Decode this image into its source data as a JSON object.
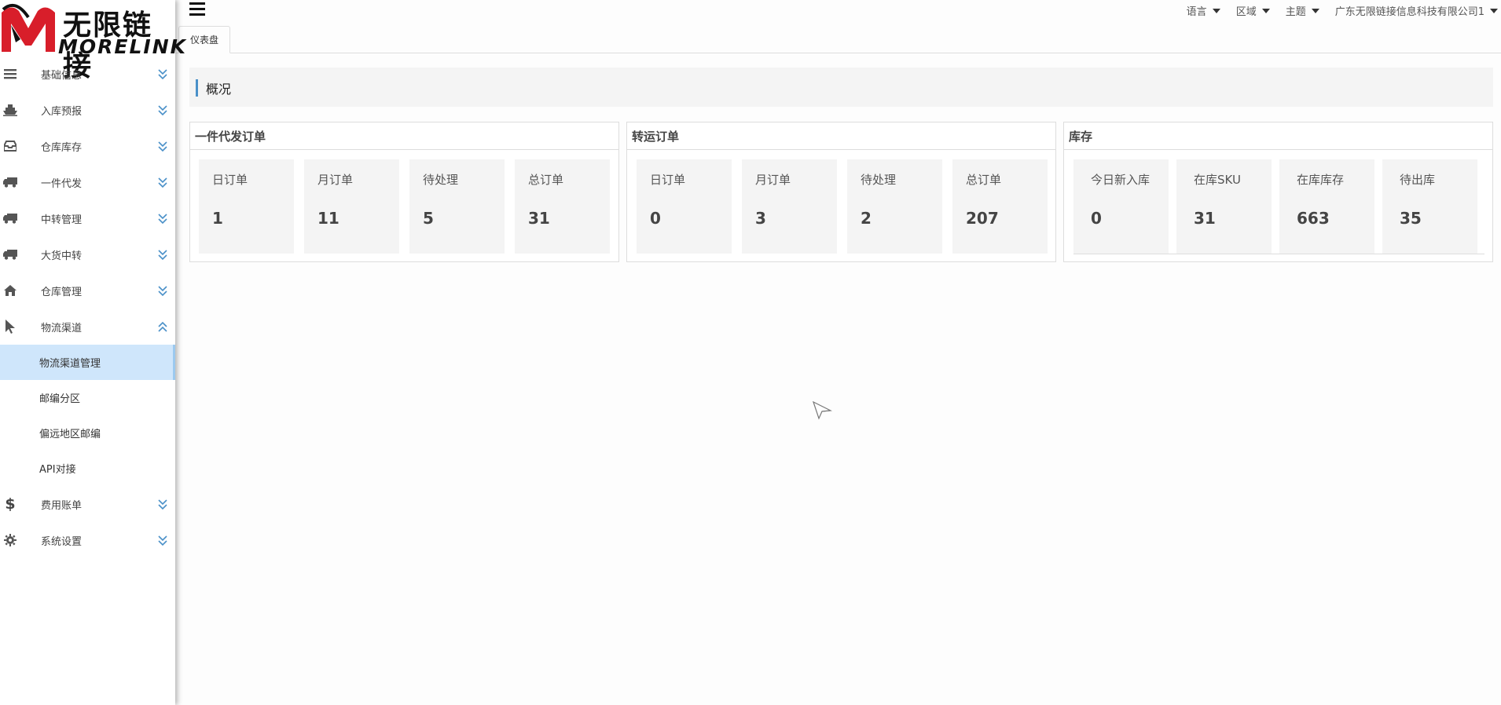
{
  "brand": {
    "name_cn": "无限链接",
    "name_en": "MORELINK",
    "accent_color": "#d81e2a"
  },
  "sidebar": {
    "items": [
      {
        "label": "基础信息",
        "icon": "list-icon",
        "expanded": false
      },
      {
        "label": "入库预报",
        "icon": "ship-icon",
        "expanded": false
      },
      {
        "label": "仓库库存",
        "icon": "inbox-icon",
        "expanded": false
      },
      {
        "label": "一件代发",
        "icon": "truck-icon",
        "expanded": false
      },
      {
        "label": "中转管理",
        "icon": "truck-icon",
        "expanded": false
      },
      {
        "label": "大货中转",
        "icon": "truck-icon",
        "expanded": false
      },
      {
        "label": "仓库管理",
        "icon": "home-icon",
        "expanded": false
      },
      {
        "label": "物流渠道",
        "icon": "pointer-icon",
        "expanded": true,
        "children": [
          {
            "label": "物流渠道管理",
            "active": true
          },
          {
            "label": "邮编分区",
            "active": false
          },
          {
            "label": "偏远地区邮编",
            "active": false
          },
          {
            "label": "API对接",
            "active": false
          }
        ]
      },
      {
        "label": "费用账单",
        "icon": "dollar-icon",
        "expanded": false
      },
      {
        "label": "系统设置",
        "icon": "gear-icon",
        "expanded": false
      }
    ]
  },
  "topbar": {
    "menus": [
      "语言",
      "区域",
      "主题",
      "广东无限链接信息科技有限公司1"
    ]
  },
  "tabs": [
    "仪表盘"
  ],
  "overview": {
    "title": "概况"
  },
  "panels": [
    {
      "title": "一件代发订单",
      "stats": [
        {
          "label": "日订单",
          "value": "1"
        },
        {
          "label": "月订单",
          "value": "11"
        },
        {
          "label": "待处理",
          "value": "5"
        },
        {
          "label": "总订单",
          "value": "31"
        }
      ]
    },
    {
      "title": "转运订单",
      "stats": [
        {
          "label": "日订单",
          "value": "0"
        },
        {
          "label": "月订单",
          "value": "3"
        },
        {
          "label": "待处理",
          "value": "2"
        },
        {
          "label": "总订单",
          "value": "207"
        }
      ]
    },
    {
      "title": "库存",
      "stats": [
        {
          "label": "今日新入库",
          "value": "0"
        },
        {
          "label": "在库SKU",
          "value": "31"
        },
        {
          "label": "在库库存",
          "value": "663"
        },
        {
          "label": "待出库",
          "value": "35"
        }
      ]
    }
  ]
}
